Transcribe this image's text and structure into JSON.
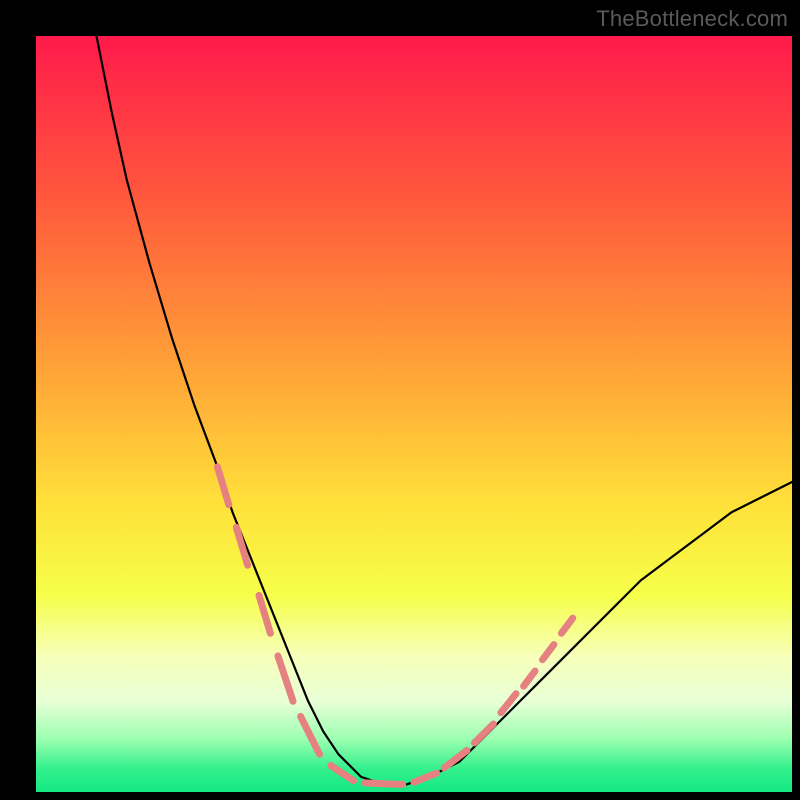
{
  "watermark": "TheBottleneck.com",
  "chart_data": {
    "type": "line",
    "title": "",
    "xlabel": "",
    "ylabel": "",
    "xlim": [
      0,
      100
    ],
    "ylim": [
      0,
      100
    ],
    "grid": false,
    "legend": false,
    "gradient_stops": [
      {
        "offset": 0,
        "color": "#ff1a4b"
      },
      {
        "offset": 22,
        "color": "#ff5a3c"
      },
      {
        "offset": 45,
        "color": "#ffa637"
      },
      {
        "offset": 62,
        "color": "#ffe13a"
      },
      {
        "offset": 74,
        "color": "#f6ff4a"
      },
      {
        "offset": 82,
        "color": "#f7ffb9"
      },
      {
        "offset": 88,
        "color": "#e8ffd6"
      },
      {
        "offset": 93,
        "color": "#9cffb1"
      },
      {
        "offset": 97,
        "color": "#32f08c"
      },
      {
        "offset": 100,
        "color": "#14e884"
      }
    ],
    "series": [
      {
        "name": "curve",
        "color": "#000000",
        "stroke_width": 2.2,
        "x": [
          8,
          10,
          12,
          15,
          18,
          21,
          24,
          26,
          28,
          30,
          32,
          34,
          36,
          38,
          40,
          43,
          46,
          49,
          52,
          56,
          60,
          64,
          68,
          72,
          76,
          80,
          84,
          88,
          92,
          96,
          100
        ],
        "y": [
          100,
          90,
          81,
          70,
          60,
          51,
          43,
          37,
          32,
          27,
          22,
          17,
          12,
          8,
          5,
          2,
          1,
          1,
          2,
          4,
          8,
          12,
          16,
          20,
          24,
          28,
          31,
          34,
          37,
          39,
          41
        ]
      }
    ],
    "markers": {
      "name": "overlay-dashes",
      "color": "#e58181",
      "stroke_width": 7,
      "segments": [
        {
          "x1": 24.0,
          "y1": 43,
          "x2": 25.5,
          "y2": 38
        },
        {
          "x1": 26.5,
          "y1": 35,
          "x2": 28.0,
          "y2": 30
        },
        {
          "x1": 29.5,
          "y1": 26,
          "x2": 31.0,
          "y2": 21
        },
        {
          "x1": 32.0,
          "y1": 18,
          "x2": 34.0,
          "y2": 12
        },
        {
          "x1": 35.0,
          "y1": 10,
          "x2": 37.5,
          "y2": 5
        },
        {
          "x1": 39.0,
          "y1": 3.5,
          "x2": 42.0,
          "y2": 1.5
        },
        {
          "x1": 43.5,
          "y1": 1.2,
          "x2": 48.5,
          "y2": 1.0
        },
        {
          "x1": 50.0,
          "y1": 1.3,
          "x2": 53.0,
          "y2": 2.5
        },
        {
          "x1": 54.0,
          "y1": 3.2,
          "x2": 57.0,
          "y2": 5.5
        },
        {
          "x1": 58.0,
          "y1": 6.5,
          "x2": 60.5,
          "y2": 9.0
        },
        {
          "x1": 61.5,
          "y1": 10.5,
          "x2": 63.5,
          "y2": 13.0
        },
        {
          "x1": 64.5,
          "y1": 14.0,
          "x2": 66.0,
          "y2": 16.0
        },
        {
          "x1": 67.0,
          "y1": 17.5,
          "x2": 68.5,
          "y2": 19.5
        },
        {
          "x1": 69.5,
          "y1": 21.0,
          "x2": 71.0,
          "y2": 23.0
        }
      ]
    }
  }
}
